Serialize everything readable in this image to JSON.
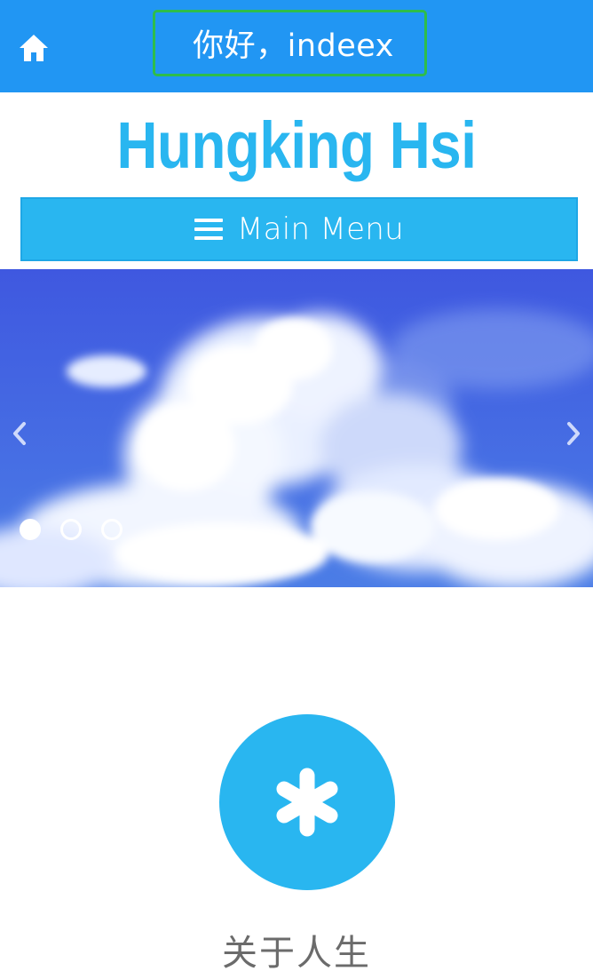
{
  "topbar": {
    "home_icon": "home-icon",
    "greeting": "你好，indeex",
    "background_color": "#2196f3",
    "highlight_border_color": "#2ebd4a"
  },
  "site": {
    "title": "Hungking Hsi",
    "accent_color": "#29b6f0"
  },
  "menu": {
    "icon": "hamburger-icon",
    "label": "Main Menu"
  },
  "slider": {
    "prev_icon": "chevron-left-icon",
    "next_icon": "chevron-right-icon",
    "slide_count": 3,
    "active_slide": 1,
    "image": "blue sky with clouds"
  },
  "feature": {
    "icon": "asterisk-icon",
    "title": "关于人生"
  }
}
